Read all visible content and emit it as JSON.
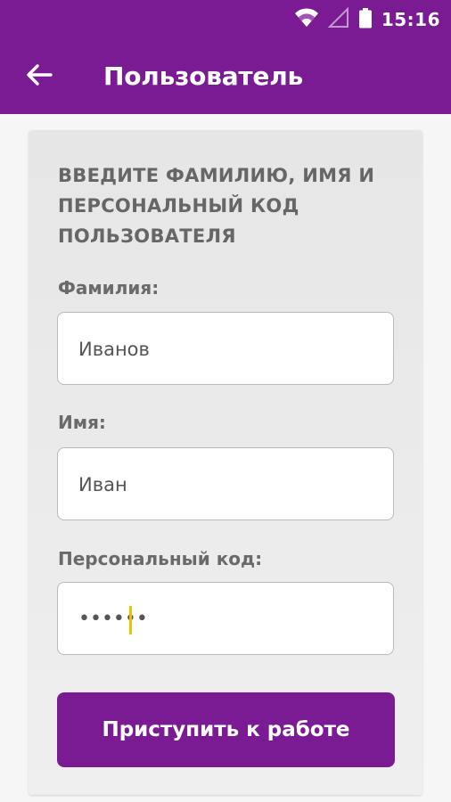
{
  "status_bar": {
    "time": "15:16",
    "icons": [
      "wifi-icon",
      "signal-icon",
      "battery-icon"
    ]
  },
  "app_bar": {
    "back_icon": "arrow-left-icon",
    "title": "Пользователь"
  },
  "form": {
    "instruction": "ВВЕДИТЕ ФАМИЛИЮ, ИМЯ И ПЕРСОНАЛЬНЫЙ КОД ПОЛЬЗОВАТЕЛЯ",
    "surname": {
      "label": "Фамилия:",
      "value": "Иванов"
    },
    "name": {
      "label": "Имя:",
      "value": "Иван"
    },
    "code": {
      "label": "Персональный код:",
      "value": "••••••"
    },
    "submit_label": "Приступить к работе"
  },
  "colors": {
    "primary": "#7b1b94",
    "caret": "#f0c000"
  }
}
